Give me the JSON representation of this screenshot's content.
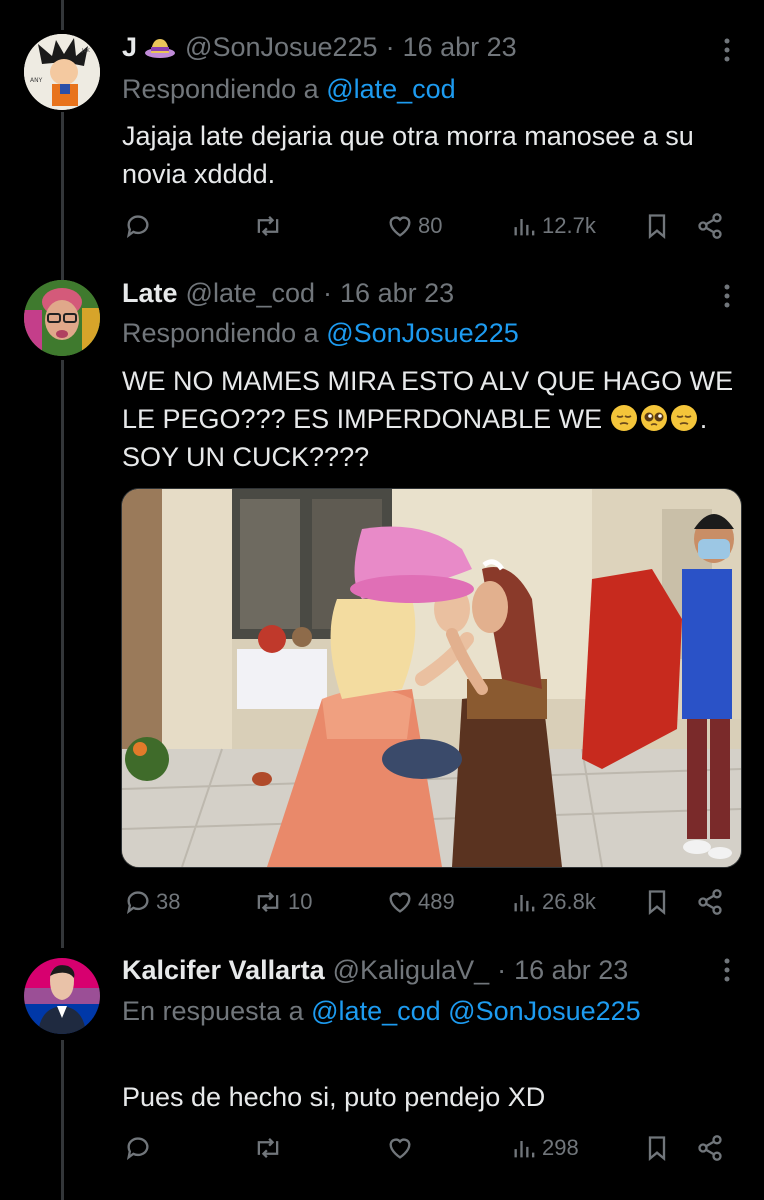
{
  "tweets": [
    {
      "name": "J",
      "handle": "@SonJosue225",
      "dot": "·",
      "date": "16 abr 23",
      "reply_prefix": "Respondiendo a",
      "reply_mentions": [
        "@late_cod"
      ],
      "text": "Jajaja late dejaria que otra morra manosee a su novia xdddd.",
      "stats": {
        "replies": "",
        "retweets": "",
        "likes": "80",
        "views": "12.7k"
      },
      "avatar_icon": "goku-avatar-icon",
      "name_emoji_icon": "hat-emoji-icon"
    },
    {
      "name": "Late",
      "handle": "@late_cod",
      "dot": "·",
      "date": "16 abr 23",
      "reply_prefix": "Respondiendo a",
      "reply_mentions": [
        "@SonJosue225"
      ],
      "text_lines": [
        "WE NO MAMES MIRA ESTO ALV QUE HAGO WE",
        "LE PEGO??? ES IMPERDONABLE WE",
        ".",
        "SOY UN CUCK????"
      ],
      "emojis": [
        "pensive-face-emoji",
        "pleading-face-emoji",
        "pensive-face-emoji"
      ],
      "stats": {
        "replies": "38",
        "retweets": "10",
        "likes": "489",
        "views": "26.8k"
      },
      "media": "photo-two-women-kissing-in-costumes",
      "avatar_icon": "person-glasses-avatar-icon"
    },
    {
      "name": "Kalcifer Vallarta",
      "handle": "@KaligulaV_",
      "dot": "·",
      "date": "16 abr 23",
      "reply_prefix": "En respuesta a",
      "reply_mentions": [
        "@late_cod",
        "@SonJosue225"
      ],
      "text": "Pues de hecho si, puto pendejo XD",
      "stats": {
        "replies": "",
        "retweets": "",
        "likes": "",
        "views": "298"
      },
      "avatar_icon": "man-suit-flag-avatar-icon"
    }
  ],
  "colors": {
    "background": "#000000",
    "text": "#e7e9ea",
    "secondary": "#71767b",
    "link": "#1d9bf0",
    "thread_line": "#333639"
  }
}
